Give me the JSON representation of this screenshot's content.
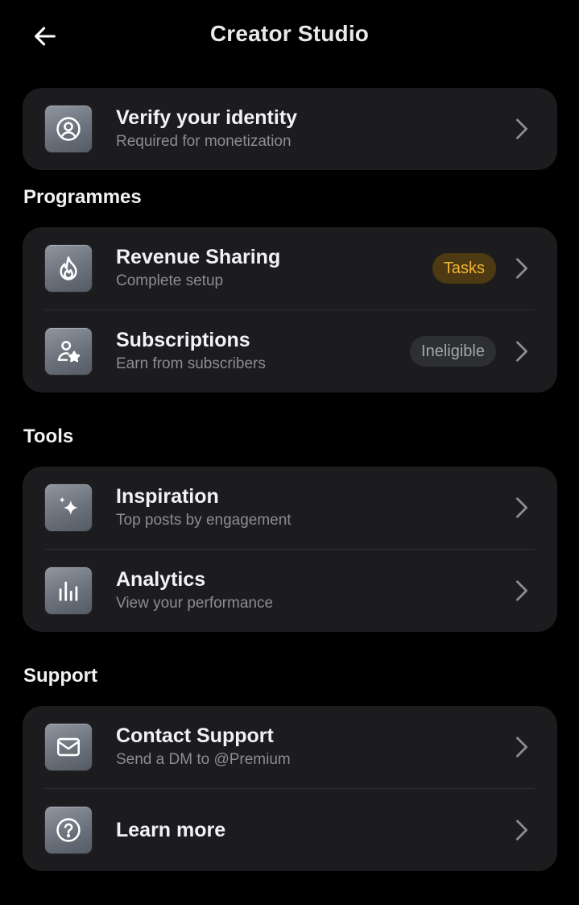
{
  "header": {
    "title": "Creator Studio",
    "back_icon": "arrow-left-icon"
  },
  "verify": {
    "title": "Verify your identity",
    "subtitle": "Required for monetization",
    "icon": "user-circle-icon"
  },
  "programmes": {
    "heading": "Programmes",
    "items": [
      {
        "title": "Revenue Sharing",
        "subtitle": "Complete setup",
        "badge": "Tasks",
        "icon": "flame-icon"
      },
      {
        "title": "Subscriptions",
        "subtitle": "Earn from subscribers",
        "badge": "Ineligible",
        "icon": "user-star-icon"
      }
    ]
  },
  "tools": {
    "heading": "Tools",
    "items": [
      {
        "title": "Inspiration",
        "subtitle": "Top posts by engagement",
        "icon": "sparkle-icon"
      },
      {
        "title": "Analytics",
        "subtitle": "View your performance",
        "icon": "bar-chart-icon"
      }
    ]
  },
  "support": {
    "heading": "Support",
    "items": [
      {
        "title": "Contact Support",
        "subtitle": "Send a DM to @Premium",
        "icon": "envelope-icon"
      },
      {
        "title": "Learn more",
        "icon": "question-circle-icon"
      }
    ]
  },
  "colors": {
    "background": "#000000",
    "card": "#1c1c1f",
    "badge_tasks_text": "#f2b632",
    "badge_tasks_bg": "#4d3a12",
    "badge_ineligible_bg": "#2e2f33",
    "subtitle": "#8b8d92"
  }
}
